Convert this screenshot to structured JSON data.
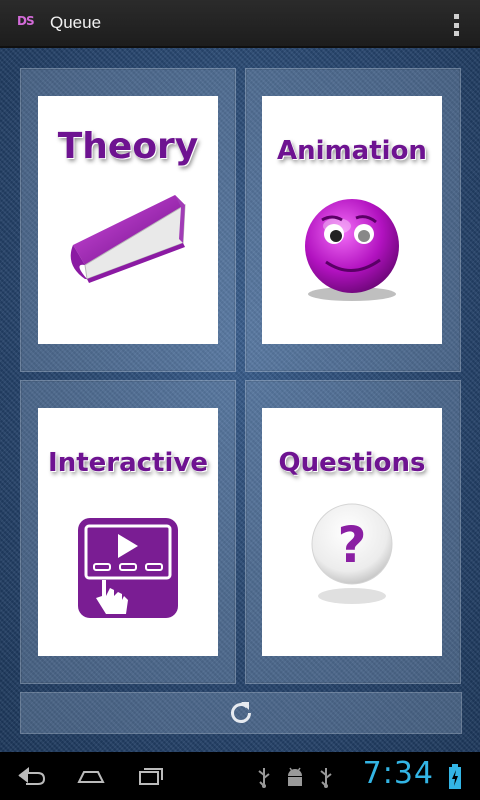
{
  "app": {
    "title": "Queue",
    "icon_text": "DS"
  },
  "cards": [
    {
      "label": "Theory",
      "icon": "book-icon"
    },
    {
      "label": "Animation",
      "icon": "smiley-icon"
    },
    {
      "label": "Interactive",
      "icon": "play-touch-icon"
    },
    {
      "label": "Questions",
      "icon": "question-icon"
    }
  ],
  "bottom": {
    "icon": "refresh-icon"
  },
  "system": {
    "time": "7:34",
    "status_icons": [
      "usb-icon",
      "android-debug-icon",
      "usb-icon",
      "battery-charging-icon"
    ]
  },
  "colors": {
    "accent_purple": "#6e1391",
    "clock_blue": "#33b5e5"
  }
}
